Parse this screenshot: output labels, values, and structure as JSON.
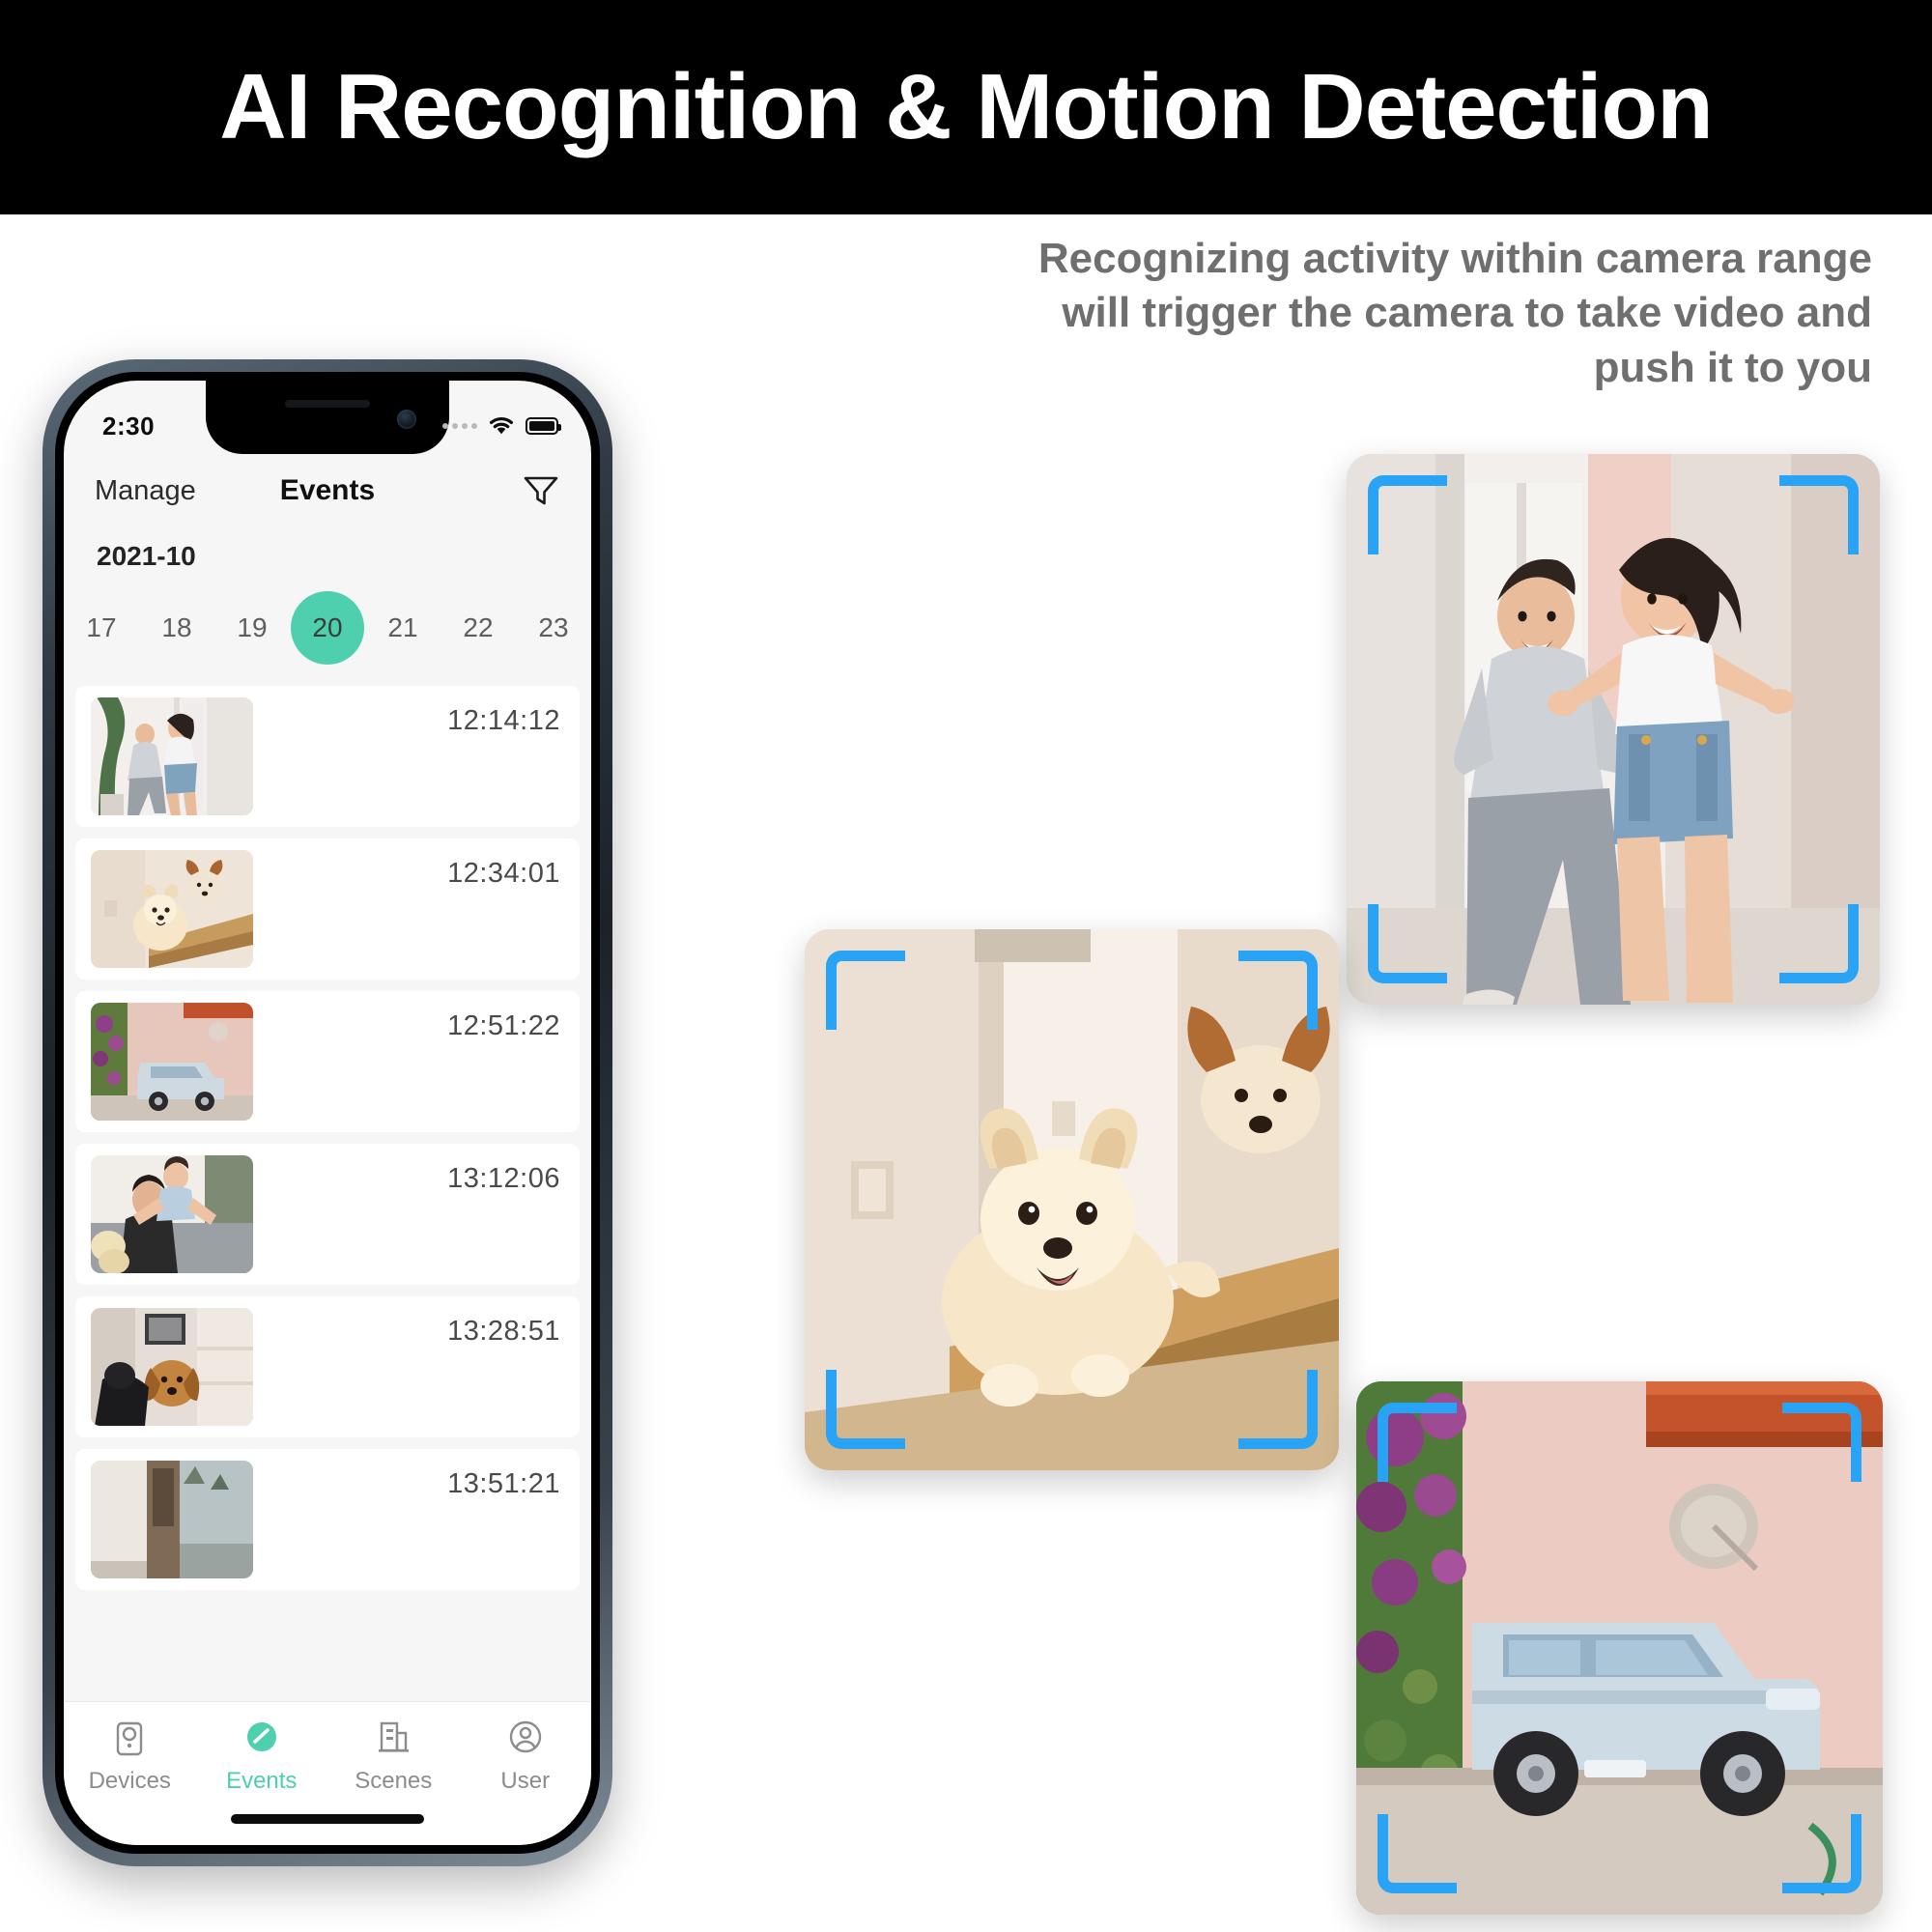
{
  "banner": {
    "title": "AI Recognition & Motion Detection",
    "background": "#000000",
    "text_color": "#ffffff"
  },
  "subtitle": {
    "text": "Recognizing activity within camera range will trigger the camera to take video and push it to you",
    "color": "#6f6f6f"
  },
  "phone": {
    "status_bar": {
      "time": "2:30",
      "signal_icon": "signal-dots-icon",
      "wifi_icon": "wifi-icon",
      "battery_icon": "battery-full-icon"
    },
    "nav": {
      "left_action": "Manage",
      "title": "Events",
      "filter_icon": "filter-funnel-icon"
    },
    "calendar": {
      "month_label": "2021-10",
      "days": [
        "17",
        "18",
        "19",
        "20",
        "21",
        "22",
        "23"
      ],
      "selected_day": "20",
      "selected_color": "#4ecfae"
    },
    "events": [
      {
        "time": "12:14:12",
        "thumb": "man-and-girl-running-indoors"
      },
      {
        "time": "12:34:01",
        "thumb": "pomeranian-dog-on-ramp"
      },
      {
        "time": "12:51:22",
        "thumb": "blue-car-by-house"
      },
      {
        "time": "13:12:06",
        "thumb": "man-with-child-on-shoulders"
      },
      {
        "time": "13:28:51",
        "thumb": "dachshund-dogs-on-porch"
      },
      {
        "time": "13:51:21",
        "thumb": "house-entrance-outdoors"
      }
    ],
    "tabs": [
      {
        "label": "Devices",
        "icon": "camera-device-icon",
        "active": false
      },
      {
        "label": "Events",
        "icon": "events-check-icon",
        "active": true
      },
      {
        "label": "Scenes",
        "icon": "building-scenes-icon",
        "active": false
      },
      {
        "label": "User",
        "icon": "user-account-icon",
        "active": false
      }
    ]
  },
  "detection_cards": [
    {
      "name": "family-running",
      "caption": "man and girl running indoors",
      "bracket_color": "#29a3f5"
    },
    {
      "name": "dog-on-ramp",
      "caption": "pomeranian dog running down ramp",
      "bracket_color": "#29a3f5"
    },
    {
      "name": "car-driveway",
      "caption": "blue car parked by pink house with bougainvillea",
      "bracket_color": "#29a3f5"
    }
  ]
}
